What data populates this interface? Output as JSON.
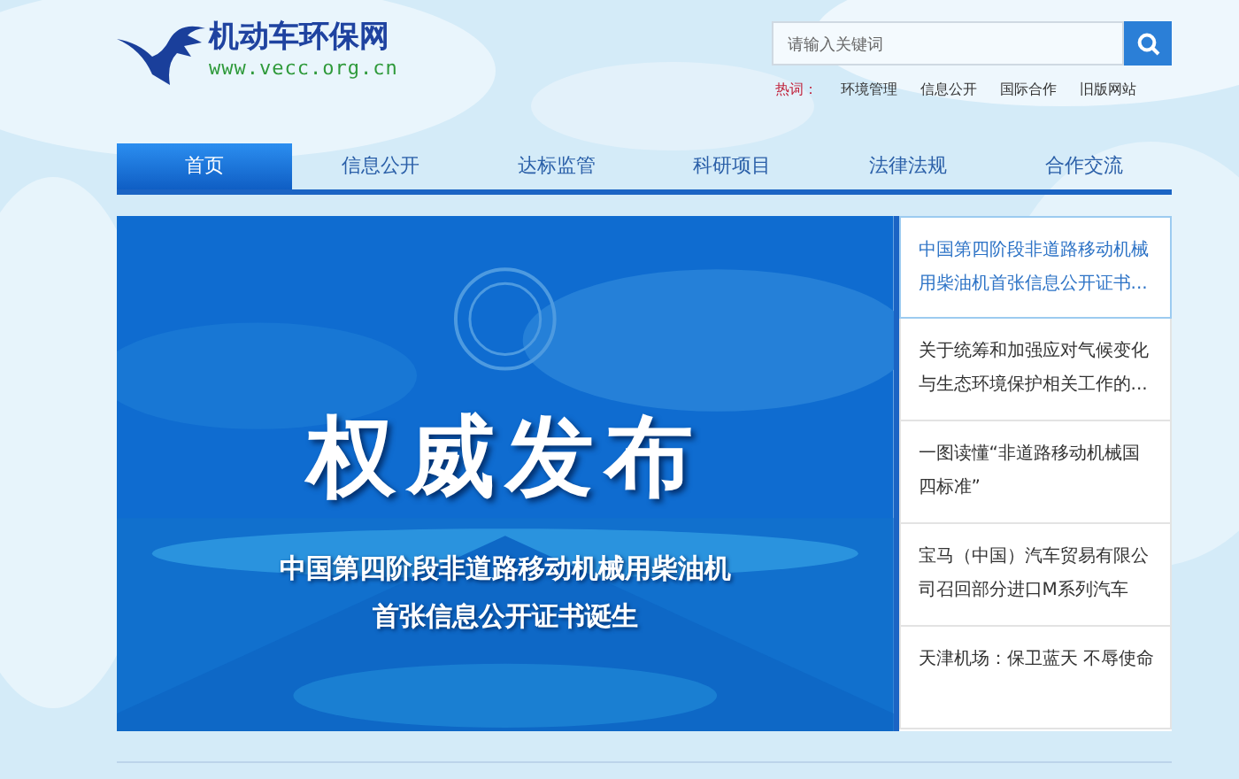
{
  "logo": {
    "name": "机动车环保网",
    "url": "www.vecc.org.cn"
  },
  "search": {
    "placeholder": "请输入关键词"
  },
  "hot_words": {
    "label": "热词：",
    "items": [
      "环境管理",
      "信息公开",
      "国际合作",
      "旧版网站"
    ]
  },
  "nav": [
    {
      "label": "首页",
      "selected": true
    },
    {
      "label": "信息公开",
      "selected": false
    },
    {
      "label": "达标监管",
      "selected": false
    },
    {
      "label": "科研项目",
      "selected": false
    },
    {
      "label": "法律法规",
      "selected": false
    },
    {
      "label": "合作交流",
      "selected": false
    }
  ],
  "banner": {
    "headline": "权威发布",
    "caption": [
      "中国第四阶段非道路移动机械用柴油机",
      "首张信息公开证书诞生"
    ]
  },
  "news": [
    {
      "title": "中国第四阶段非道路移动机械用柴油机首张信息公开证书...",
      "selected": true
    },
    {
      "title": "关于统筹和加强应对气候变化与生态环境保护相关工作的...",
      "selected": false
    },
    {
      "title": "一图读懂“非道路移动机械国四标准”",
      "selected": false
    },
    {
      "title": "宝马（中国）汽车贸易有限公司召回部分进口M系列汽车",
      "selected": false
    },
    {
      "title": "天津机场：保卫蓝天 不辱使命",
      "selected": false
    }
  ]
}
